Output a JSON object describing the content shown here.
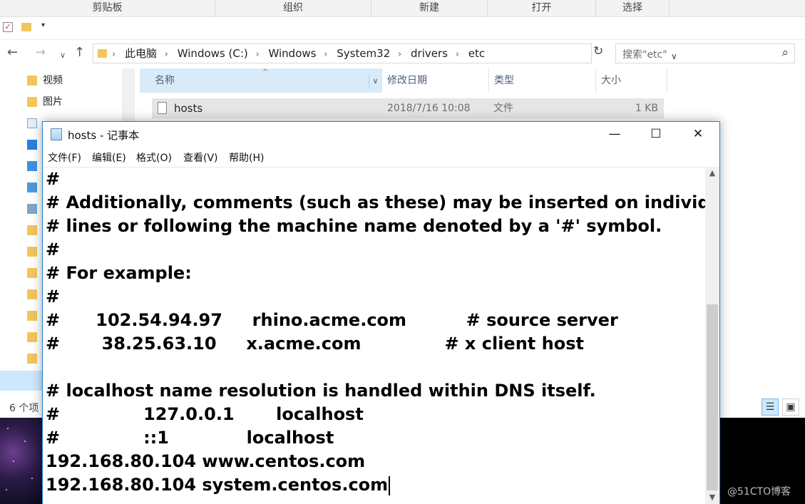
{
  "ribbon": {
    "groups": [
      "剪贴板",
      "组织",
      "新建",
      "打开",
      "选择"
    ]
  },
  "address_bar": {
    "crumbs": [
      "此电脑",
      "Windows (C:)",
      "Windows",
      "System32",
      "drivers",
      "etc"
    ],
    "search_placeholder": "搜索\"etc\""
  },
  "nav_pane": {
    "items": [
      "视频",
      "图片"
    ]
  },
  "file_list": {
    "columns": [
      "名称",
      "修改日期",
      "类型",
      "大小"
    ],
    "rows": [
      {
        "name": "hosts",
        "modified": "2018/7/16 10:08",
        "type": "文件",
        "size": "1 KB"
      }
    ]
  },
  "status_bar": {
    "item_count": "6 个项"
  },
  "notepad": {
    "title": "hosts - 记事本",
    "menu": [
      "文件(F)",
      "编辑(E)",
      "格式(O)",
      "查看(V)",
      "帮助(H)"
    ],
    "lines": [
      "#",
      "# Additionally, comments (such as these) may be inserted on individual",
      "# lines or following the machine name denoted by a '#' symbol.",
      "#",
      "# For example:",
      "#",
      "#      102.54.94.97     rhino.acme.com          # source server",
      "#       38.25.63.10     x.acme.com              # x client host",
      "",
      "# localhost name resolution is handled within DNS itself.",
      "#              127.0.0.1       localhost",
      "#              ::1             localhost",
      "192.168.80.104 www.centos.com",
      "192.168.80.104 system.centos.com"
    ]
  },
  "watermark": "@51CTO博客",
  "colors": {
    "selection": "#cce8ff",
    "column_header_active": "#d9ebf9",
    "window_border": "#1883d7",
    "folder": "#f2c65a"
  }
}
